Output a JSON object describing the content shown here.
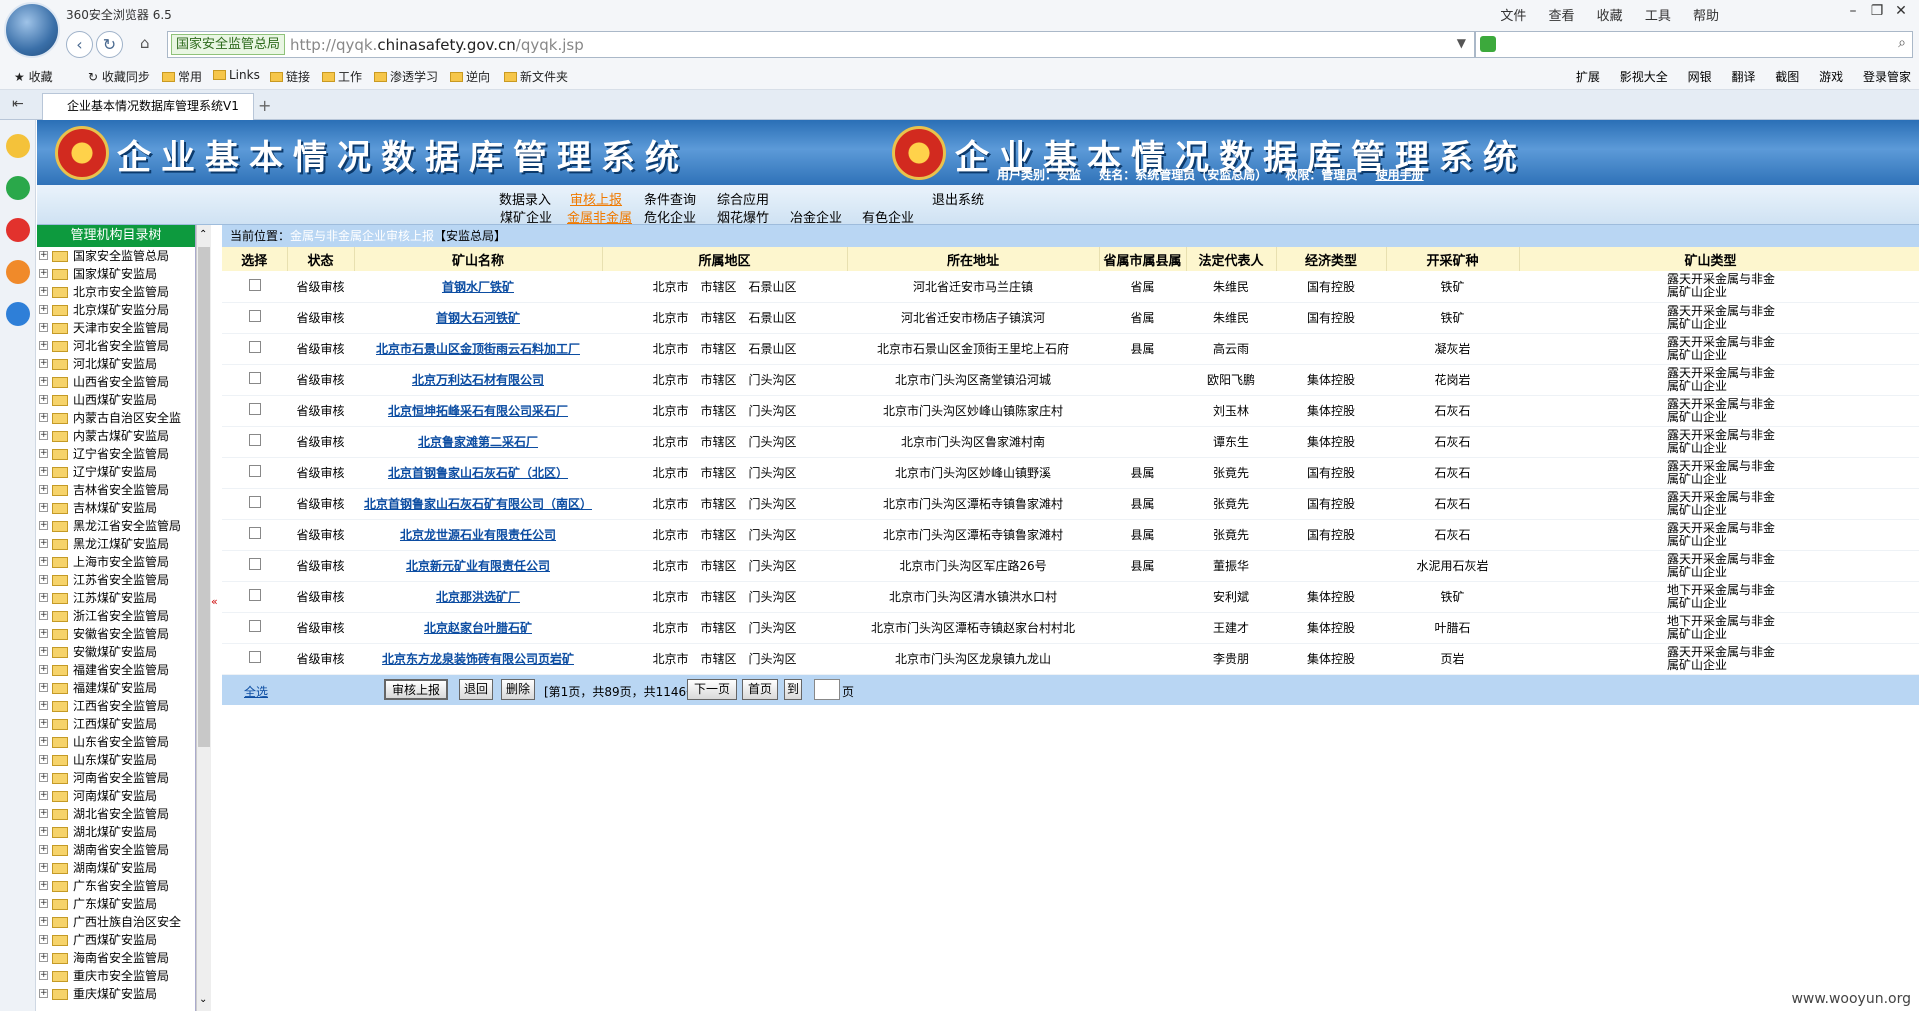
{
  "browser": {
    "title": "360安全浏览器 6.5",
    "menu": [
      "文件",
      "查看",
      "收藏",
      "工具",
      "帮助"
    ],
    "site_badge": "国家安全监管总局",
    "url_prefix": "http://qyqk.",
    "url_domain": "chinasafety.gov.cn",
    "url_path": "/qyqk.jsp",
    "favorites": [
      "收藏",
      "收藏同步",
      "常用",
      "Links",
      "链接",
      "工作",
      "渗透学习",
      "逆向",
      "新文件夹"
    ],
    "right_tools": [
      "扩展",
      "影视大全",
      "网银",
      "翻译",
      "截图",
      "游戏",
      "登录管家"
    ],
    "tab_title": "企业基本情况数据库管理系统V1"
  },
  "banner": {
    "title": "企业基本情况数据库管理系统",
    "user_type": "用户类别：安监",
    "user_name": "姓名：系统管理员（安监总局）",
    "permission": "权限：管理员",
    "manual": "使用手册"
  },
  "menu_top": [
    "数据录入",
    "审核上报",
    "条件查询",
    "综合应用",
    "退出系统"
  ],
  "menu_sub": [
    "煤矿企业",
    "金属非金属",
    "危化企业",
    "烟花爆竹",
    "冶金企业",
    "有色企业"
  ],
  "tree": {
    "header": "管理机构目录树",
    "items": [
      "国家安全监管总局",
      "国家煤矿安监局",
      "北京市安全监管局",
      "北京煤矿安监分局",
      "天津市安全监管局",
      "河北省安全监管局",
      "河北煤矿安监局",
      "山西省安全监管局",
      "山西煤矿安监局",
      "内蒙古自治区安全监",
      "内蒙古煤矿安监局",
      "辽宁省安全监管局",
      "辽宁煤矿安监局",
      "吉林省安全监管局",
      "吉林煤矿安监局",
      "黑龙江省安全监管局",
      "黑龙江煤矿安监局",
      "上海市安全监管局",
      "江苏省安全监管局",
      "江苏煤矿安监局",
      "浙江省安全监管局",
      "安徽省安全监管局",
      "安徽煤矿安监局",
      "福建省安全监管局",
      "福建煤矿安监局",
      "江西省安全监管局",
      "江西煤矿安监局",
      "山东省安全监管局",
      "山东煤矿安监局",
      "河南省安全监管局",
      "河南煤矿安监局",
      "湖北省安全监管局",
      "湖北煤矿安监局",
      "湖南省安全监管局",
      "湖南煤矿安监局",
      "广东省安全监管局",
      "广东煤矿安监局",
      "广西壮族自治区安全",
      "广西煤矿安监局",
      "海南省安全监管局",
      "重庆市安全监管局",
      "重庆煤矿安监局"
    ]
  },
  "breadcrumb": {
    "label": "当前位置：",
    "location": "金属与非金属企业审核上报",
    "org": "【安监总局】"
  },
  "columns": [
    "选择",
    "状态",
    "矿山名称",
    "所属地区",
    "所在地址",
    "省属市属县属",
    "法定代表人",
    "经济类型",
    "开采矿种",
    "矿山类型"
  ],
  "rows": [
    {
      "status": "省级审核",
      "name": "首钢水厂铁矿",
      "region": "北京市　市辖区　石景山区",
      "address": "河北省迁安市马兰庄镇",
      "level": "省属",
      "rep": "朱维民",
      "econ": "国有控股",
      "mineral": "铁矿",
      "type": "露天开采金属与非金属矿山企业"
    },
    {
      "status": "省级审核",
      "name": "首钢大石河铁矿",
      "region": "北京市　市辖区　石景山区",
      "address": "河北省迁安市杨店子镇滨河",
      "level": "省属",
      "rep": "朱维民",
      "econ": "国有控股",
      "mineral": "铁矿",
      "type": "露天开采金属与非金属矿山企业"
    },
    {
      "status": "省级审核",
      "name": "北京市石景山区金顶街雨云石料加工厂",
      "region": "北京市　市辖区　石景山区",
      "address": "北京市石景山区金顶街王里坨上石府",
      "level": "县属",
      "rep": "高云雨",
      "econ": "",
      "mineral": "凝灰岩",
      "type": "露天开采金属与非金属矿山企业"
    },
    {
      "status": "省级审核",
      "name": "北京万利达石材有限公司",
      "region": "北京市　市辖区　门头沟区",
      "address": "北京市门头沟区斋堂镇沿河城",
      "level": "",
      "rep": "欧阳飞鹏",
      "econ": "集体控股",
      "mineral": "花岗岩",
      "type": "露天开采金属与非金属矿山企业"
    },
    {
      "status": "省级审核",
      "name": "北京恒坤拓峰采石有限公司采石厂",
      "region": "北京市　市辖区　门头沟区",
      "address": "北京市门头沟区妙峰山镇陈家庄村",
      "level": "",
      "rep": "刘玉林",
      "econ": "集体控股",
      "mineral": "石灰石",
      "type": "露天开采金属与非金属矿山企业"
    },
    {
      "status": "省级审核",
      "name": "北京鲁家滩第二采石厂",
      "region": "北京市　市辖区　门头沟区",
      "address": "北京市门头沟区鲁家滩村南",
      "level": "",
      "rep": "谭东生",
      "econ": "集体控股",
      "mineral": "石灰石",
      "type": "露天开采金属与非金属矿山企业"
    },
    {
      "status": "省级审核",
      "name": "北京首钢鲁家山石灰石矿（北区）",
      "region": "北京市　市辖区　门头沟区",
      "address": "北京市门头沟区妙峰山镇野溪",
      "level": "县属",
      "rep": "张竟先",
      "econ": "国有控股",
      "mineral": "石灰石",
      "type": "露天开采金属与非金属矿山企业"
    },
    {
      "status": "省级审核",
      "name": "北京首钢鲁家山石灰石矿有限公司（南区）",
      "region": "北京市　市辖区　门头沟区",
      "address": "北京市门头沟区潭柘寺镇鲁家滩村",
      "level": "县属",
      "rep": "张竟先",
      "econ": "国有控股",
      "mineral": "石灰石",
      "type": "露天开采金属与非金属矿山企业"
    },
    {
      "status": "省级审核",
      "name": "北京龙世源石业有限责任公司",
      "region": "北京市　市辖区　门头沟区",
      "address": "北京市门头沟区潭柘寺镇鲁家滩村",
      "level": "县属",
      "rep": "张竟先",
      "econ": "国有控股",
      "mineral": "石灰石",
      "type": "露天开采金属与非金属矿山企业"
    },
    {
      "status": "省级审核",
      "name": "北京新元矿业有限责任公司",
      "region": "北京市　市辖区　门头沟区",
      "address": "北京市门头沟区军庄路26号",
      "level": "县属",
      "rep": "董振华",
      "econ": "",
      "mineral": "水泥用石灰岩",
      "type": "露天开采金属与非金属矿山企业"
    },
    {
      "status": "省级审核",
      "name": "北京那洪选矿厂",
      "region": "北京市　市辖区　门头沟区",
      "address": "北京市门头沟区清水镇洪水口村",
      "level": "",
      "rep": "安利斌",
      "econ": "集体控股",
      "mineral": "铁矿",
      "type": "地下开采金属与非金属矿山企业"
    },
    {
      "status": "省级审核",
      "name": "北京赵家台叶腊石矿",
      "region": "北京市　市辖区　门头沟区",
      "address": "北京市门头沟区潭柘寺镇赵家台村村北",
      "level": "",
      "rep": "王建才",
      "econ": "集体控股",
      "mineral": "叶腊石",
      "type": "地下开采金属与非金属矿山企业"
    },
    {
      "status": "省级审核",
      "name": "北京东方龙泉装饰砖有限公司页岩矿",
      "region": "北京市　市辖区　门头沟区",
      "address": "北京市门头沟区龙泉镇九龙山",
      "level": "",
      "rep": "李贵朋",
      "econ": "集体控股",
      "mineral": "页岩",
      "type": "露天开采金属与非金属矿山企业"
    }
  ],
  "footer": {
    "select_all": "全选",
    "submit": "审核上报",
    "back": "退回",
    "delete": "删除",
    "page_info": "[第1页，共89页，共1146条]",
    "next": "下一页",
    "first": "首页",
    "goto": "到",
    "page_unit": "页"
  },
  "watermark": "www.wooyun.org"
}
